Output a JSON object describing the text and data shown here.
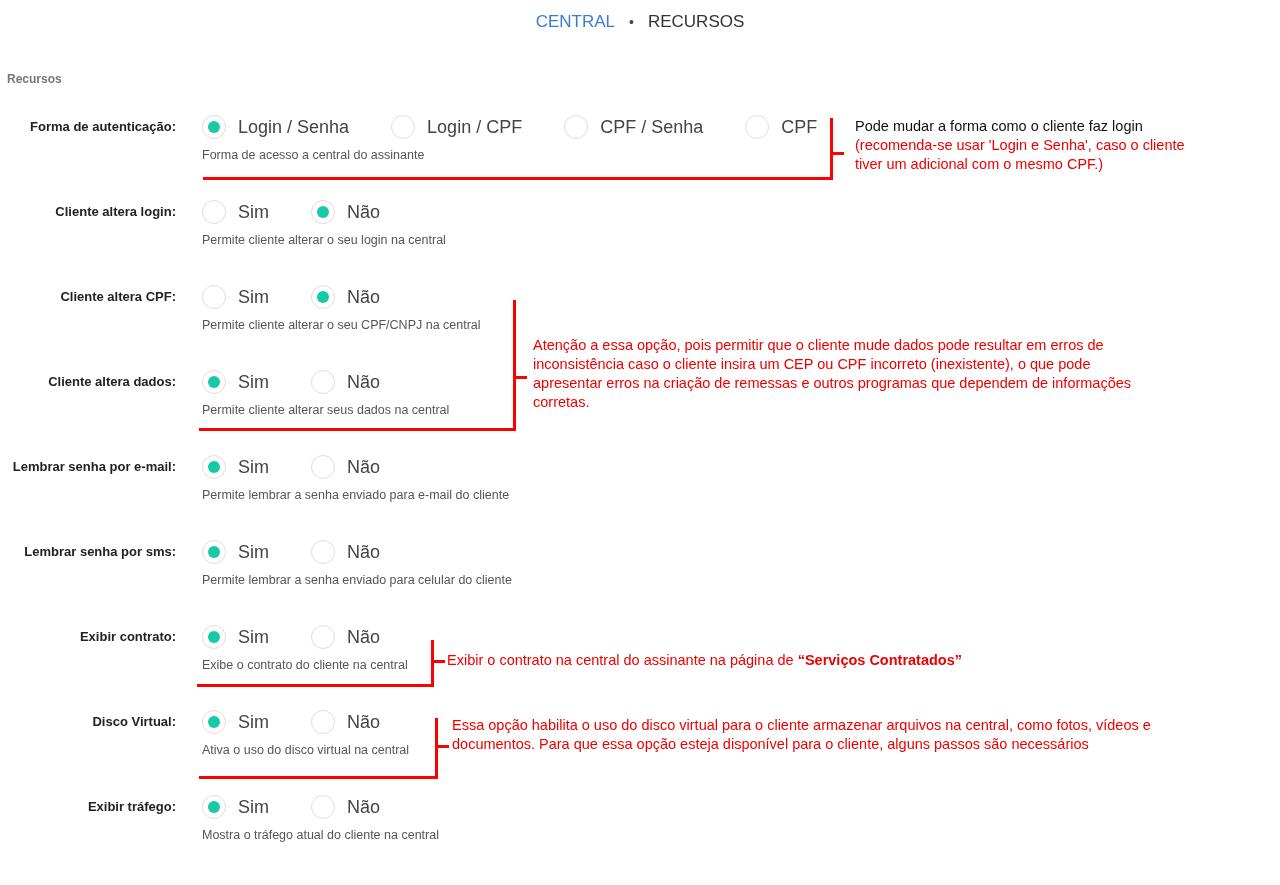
{
  "breadcrumb": {
    "separator": "•",
    "items": [
      {
        "label": "CENTRAL",
        "link": true
      },
      {
        "label": "RECURSOS",
        "link": false
      }
    ]
  },
  "section_title": "Recursos",
  "fields": [
    {
      "label": "Forma de autenticação:",
      "hint": "Forma de acesso a central do assinante",
      "options": [
        {
          "label": "Login / Senha",
          "selected": true
        },
        {
          "label": "Login / CPF",
          "selected": false
        },
        {
          "label": "CPF / Senha",
          "selected": false
        },
        {
          "label": "CPF",
          "selected": false
        }
      ]
    },
    {
      "label": "Cliente altera login:",
      "hint": "Permite cliente alterar o seu login na central",
      "options": [
        {
          "label": "Sim",
          "selected": false
        },
        {
          "label": "Não",
          "selected": true
        }
      ]
    },
    {
      "label": "Cliente altera CPF:",
      "hint": "Permite cliente alterar o seu CPF/CNPJ na central",
      "options": [
        {
          "label": "Sim",
          "selected": false
        },
        {
          "label": "Não",
          "selected": true
        }
      ]
    },
    {
      "label": "Cliente altera dados:",
      "hint": "Permite cliente alterar seus dados na central",
      "options": [
        {
          "label": "Sim",
          "selected": true
        },
        {
          "label": "Não",
          "selected": false
        }
      ]
    },
    {
      "label": "Lembrar senha por e-mail:",
      "hint": "Permite lembrar a senha enviado para e-mail do cliente",
      "options": [
        {
          "label": "Sim",
          "selected": true
        },
        {
          "label": "Não",
          "selected": false
        }
      ]
    },
    {
      "label": "Lembrar senha por sms:",
      "hint": "Permite lembrar a senha enviado para celular do cliente",
      "options": [
        {
          "label": "Sim",
          "selected": true
        },
        {
          "label": "Não",
          "selected": false
        }
      ]
    },
    {
      "label": "Exibir contrato:",
      "hint": "Exibe o contrato do cliente na central",
      "options": [
        {
          "label": "Sim",
          "selected": true
        },
        {
          "label": "Não",
          "selected": false
        }
      ]
    },
    {
      "label": "Disco Virtual:",
      "hint": "Ativa o uso do disco virtual na central",
      "options": [
        {
          "label": "Sim",
          "selected": true
        },
        {
          "label": "Não",
          "selected": false
        }
      ]
    },
    {
      "label": "Exibir tráfego:",
      "hint": "Mostra o tráfego atual do cliente na central",
      "options": [
        {
          "label": "Sim",
          "selected": true
        },
        {
          "label": "Não",
          "selected": false
        }
      ]
    }
  ],
  "annotations": [
    {
      "title": "Pode mudar a forma como o cliente faz login",
      "text": "(recomenda-se usar 'Login e Senha', caso o cliente tiver um adicional com o mesmo CPF.)"
    },
    {
      "text": "Atenção a essa opção, pois permitir que o cliente mude dados pode resultar em erros de inconsistência caso o cliente insira um CEP ou CPF incorreto (inexistente), o que pode apresentar erros na criação de remessas e outros programas que dependem de informações corretas."
    },
    {
      "text": "Exibir o contrato na central do assinante na página de **“Serviços Contratados”**"
    },
    {
      "text": "Essa opção habilita o uso do disco virtual para o cliente armazenar arquivos na central, como fotos, vídeos e documentos. Para que essa opção esteja disponível para o cliente, alguns passos são necessários"
    }
  ]
}
